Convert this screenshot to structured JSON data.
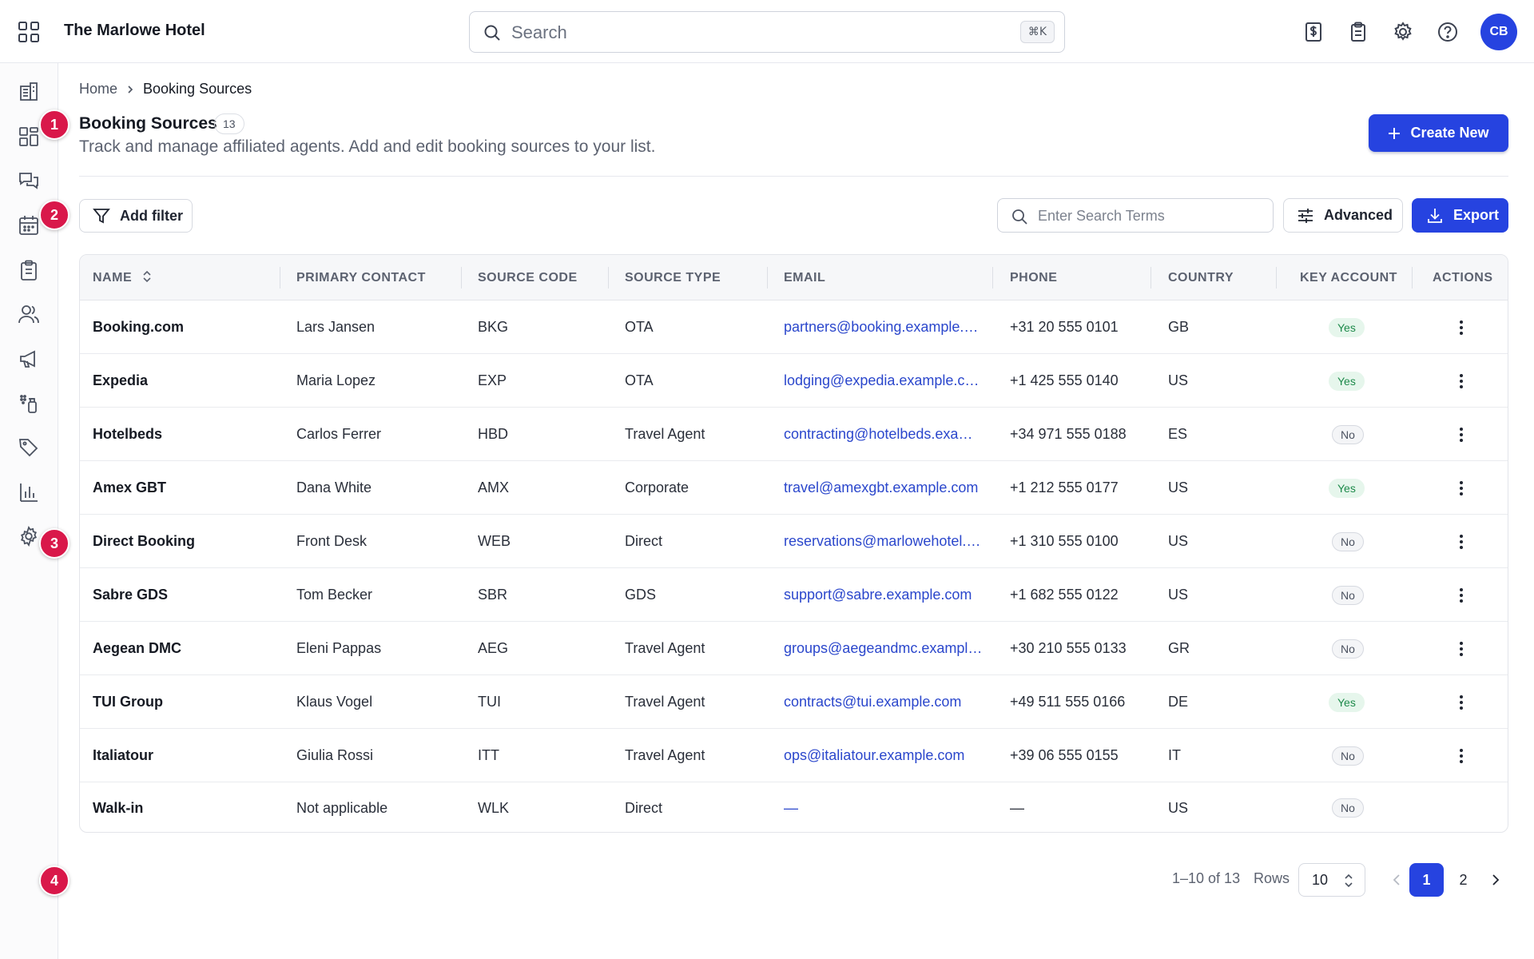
{
  "app": {
    "hotel_name": "The Marlowe Hotel",
    "search_placeholder": "Search",
    "search_shortcut": "⌘K",
    "user_initials": "CB",
    "accent_color": "#2643e0",
    "marker_color": "#d9184a"
  },
  "top_icons": [
    "billing-icon",
    "clipboard-icon",
    "settings-gear-icon",
    "help-icon"
  ],
  "rail": {
    "items": [
      "building-icon",
      "dashboard-icon",
      "messages-icon",
      "calendar-icon",
      "clipboard-list-icon",
      "guests-icon",
      "megaphone-icon",
      "housekeeping-icon",
      "tags-icon",
      "reports-icon",
      "settings-icon"
    ]
  },
  "markers": [
    "1",
    "2",
    "3",
    "4"
  ],
  "breadcrumb": {
    "home": "Home",
    "current": "Booking Sources"
  },
  "header": {
    "title": "Booking Sources",
    "count": "13",
    "subtitle": "Track and manage affiliated agents. Add and edit booking sources to your list.",
    "create_label": "Create New"
  },
  "toolbar": {
    "filter_label": "Add filter",
    "search_placeholder": "Enter Search Terms",
    "advanced_label": "Advanced",
    "export_label": "Export"
  },
  "table": {
    "columns": [
      "NAME",
      "PRIMARY CONTACT",
      "SOURCE CODE",
      "SOURCE TYPE",
      "EMAIL",
      "PHONE",
      "COUNTRY",
      "KEY ACCOUNT",
      "ACTIONS"
    ],
    "rows": [
      {
        "name": "Booking.com",
        "contact": "Lars Jansen",
        "code": "BKG",
        "type": "OTA",
        "email": "partners@booking.example.com",
        "phone": "+31 20 555 0101",
        "country": "GB",
        "key": "Yes",
        "has_actions": true
      },
      {
        "name": "Expedia",
        "contact": "Maria Lopez",
        "code": "EXP",
        "type": "OTA",
        "email": "lodging@expedia.example.com",
        "phone": "+1 425 555 0140",
        "country": "US",
        "key": "Yes",
        "has_actions": true
      },
      {
        "name": "Hotelbeds",
        "contact": "Carlos Ferrer",
        "code": "HBD",
        "type": "Travel Agent",
        "email": "contracting@hotelbeds.example.com",
        "phone": "+34 971 555 0188",
        "country": "ES",
        "key": "No",
        "has_actions": true
      },
      {
        "name": "Amex GBT",
        "contact": "Dana White",
        "code": "AMX",
        "type": "Corporate",
        "email": "travel@amexgbt.example.com",
        "phone": "+1 212 555 0177",
        "country": "US",
        "key": "Yes",
        "has_actions": true
      },
      {
        "name": "Direct Booking",
        "contact": "Front Desk",
        "code": "WEB",
        "type": "Direct",
        "email": "reservations@marlowehotel.example.com",
        "phone": "+1 310 555 0100",
        "country": "US",
        "key": "No",
        "has_actions": true
      },
      {
        "name": "Sabre GDS",
        "contact": "Tom Becker",
        "code": "SBR",
        "type": "GDS",
        "email": "support@sabre.example.com",
        "phone": "+1 682 555 0122",
        "country": "US",
        "key": "No",
        "has_actions": true
      },
      {
        "name": "Aegean DMC",
        "contact": "Eleni Pappas",
        "code": "AEG",
        "type": "Travel Agent",
        "email": "groups@aegeandmc.example.com",
        "phone": "+30 210 555 0133",
        "country": "GR",
        "key": "No",
        "has_actions": true
      },
      {
        "name": "TUI Group",
        "contact": "Klaus Vogel",
        "code": "TUI",
        "type": "Travel Agent",
        "email": "contracts@tui.example.com",
        "phone": "+49 511 555 0166",
        "country": "DE",
        "key": "Yes",
        "has_actions": true
      },
      {
        "name": "Italiatour",
        "contact": "Giulia Rossi",
        "code": "ITT",
        "type": "Travel Agent",
        "email": "ops@italiatour.example.com",
        "phone": "+39 06 555 0155",
        "country": "IT",
        "key": "No",
        "has_actions": true
      },
      {
        "name": "Walk-in",
        "contact": "Not applicable",
        "code": "WLK",
        "type": "Direct",
        "email": "—",
        "phone": "—",
        "country": "US",
        "key": "No",
        "has_actions": false
      }
    ]
  },
  "pagination": {
    "range": "1–10 of 13",
    "rows_label": "Rows",
    "rows_value": "10",
    "pages": [
      "1",
      "2"
    ],
    "current_page": "1"
  }
}
